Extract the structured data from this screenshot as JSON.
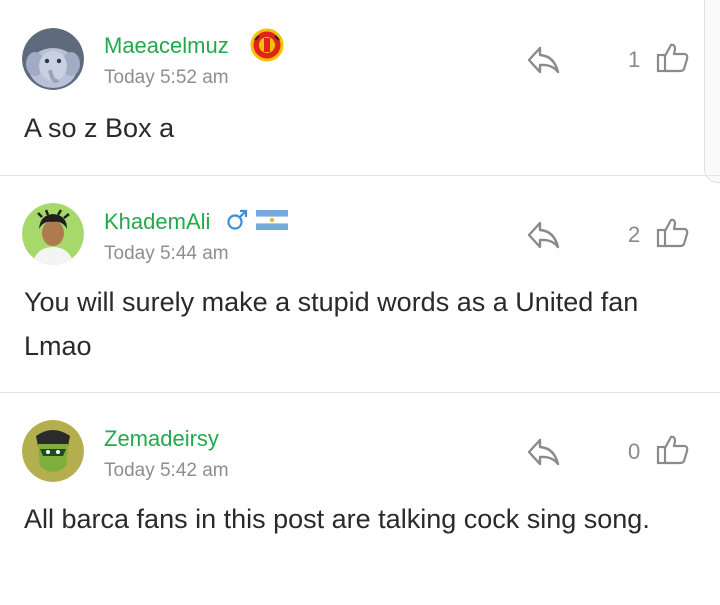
{
  "colors": {
    "username": "#22a94a",
    "timestamp": "#8e8e8e",
    "icon": "#8a8a8a",
    "text": "#2a2a2a"
  },
  "comments": [
    {
      "username": "Maeacelmuz",
      "badge": "club-crest-icon",
      "timestamp": "Today 5:52 am",
      "likes": "1",
      "text": "A so z Box a"
    },
    {
      "username": "KhademAli",
      "badge": "male-symbol-icon",
      "flag": "argentina-flag-icon",
      "timestamp": "Today 5:44 am",
      "likes": "2",
      "text": "You will surely make a stupid words as a United fan Lmao"
    },
    {
      "username": "Zemadeirsy",
      "timestamp": "Today 5:42 am",
      "likes": "0",
      "text": "All barca fans in this post are talking cock sing song."
    }
  ]
}
